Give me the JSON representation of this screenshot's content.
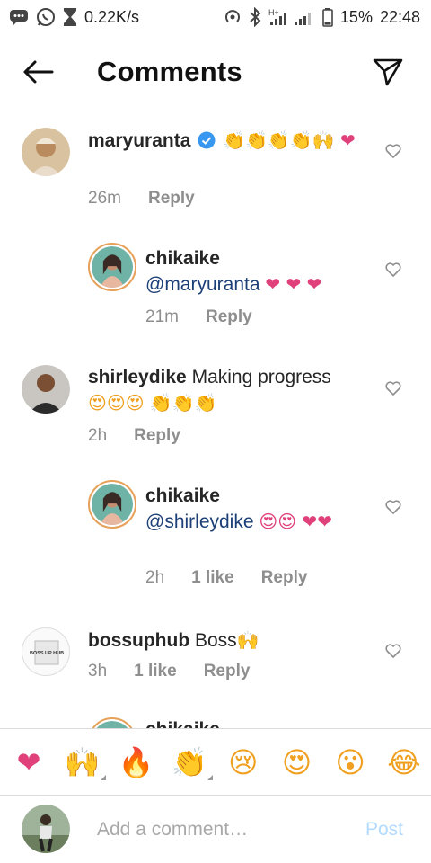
{
  "status_bar": {
    "speed": "0.22K/s",
    "network": "H+",
    "battery": "15%",
    "time": "22:48",
    "icons": [
      "messages-icon",
      "whatsapp-icon",
      "hourglass-icon",
      "hotspot-icon",
      "bluetooth-icon",
      "signal-icon",
      "battery-icon"
    ]
  },
  "header": {
    "title": "Comments",
    "back_icon": "back-arrow-icon",
    "send_icon": "send-icon"
  },
  "comments": [
    {
      "username": "maryuranta",
      "verified": true,
      "text": "",
      "emojis": "👏👏👏👏🙌 ❤",
      "time": "26m",
      "likes": "",
      "reply": "Reply"
    },
    {
      "username": "chikaike",
      "mention": "@maryuranta",
      "text": "",
      "emojis": "❤ ❤ ❤",
      "time": "21m",
      "likes": "",
      "reply": "Reply"
    },
    {
      "username": "shirleydike",
      "text": "Making progress",
      "emojis": "😍😍😍 👏👏👏",
      "time": "2h",
      "likes": "",
      "reply": "Reply"
    },
    {
      "username": "chikaike",
      "mention": "@shirleydike",
      "text": "",
      "emojis": "😍😍 ❤❤",
      "time": "2h",
      "likes": "1 like",
      "reply": "Reply"
    },
    {
      "username": "bossuphub",
      "text": "Boss",
      "emojis": "🙌",
      "time": "3h",
      "likes": "1 like",
      "reply": "Reply",
      "avatar_text": "BOSS UP HUB"
    },
    {
      "username": "chikaike"
    }
  ],
  "reactions": [
    "❤",
    "🙌",
    "🔥",
    "👏",
    "😢",
    "😍",
    "😮",
    "😂"
  ],
  "composer": {
    "placeholder": "Add a comment…",
    "post_label": "Post"
  },
  "colors": {
    "mention": "#1c3f77",
    "post_disabled": "#b3dbff",
    "verified": "#3897f0",
    "heart": "#e0417a"
  }
}
